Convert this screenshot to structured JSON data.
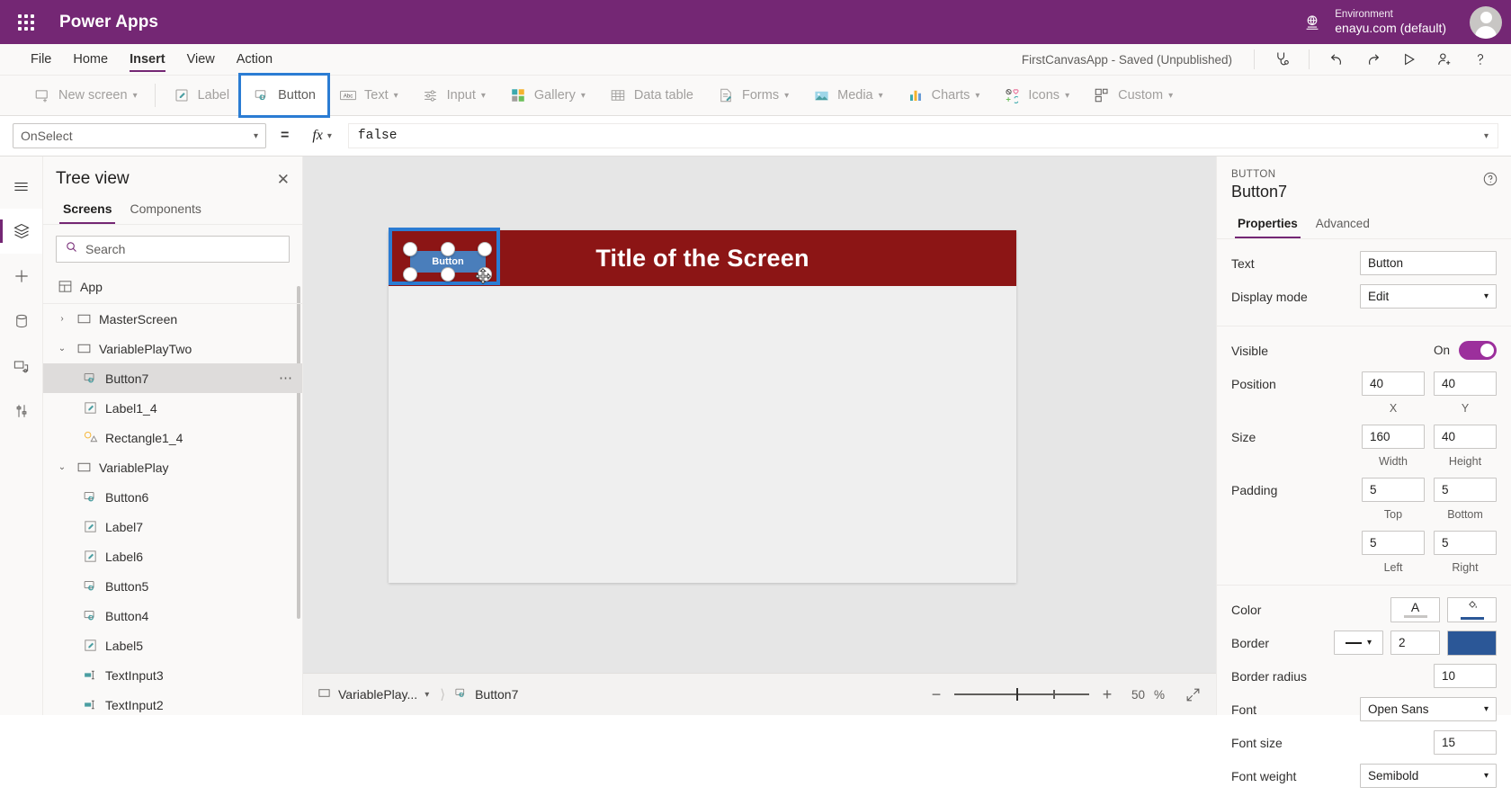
{
  "topbar": {
    "waffle_label": "app-launcher",
    "brand": "Power Apps",
    "environment_label": "Environment",
    "environment_name": "enayu.com (default)"
  },
  "menubar": {
    "items": [
      "File",
      "Home",
      "Insert",
      "View",
      "Action"
    ],
    "active": "Insert",
    "saved_status": "FirstCanvasApp - Saved (Unpublished)",
    "icons": [
      "health-check-icon",
      "undo-icon",
      "redo-icon",
      "play-icon",
      "share-icon",
      "help-icon"
    ]
  },
  "ribbon": {
    "items": [
      {
        "label": "New screen",
        "icon": "new-screen-icon",
        "caret": true,
        "selected": false
      },
      {
        "label": "Label",
        "icon": "label-icon",
        "caret": false,
        "selected": false
      },
      {
        "label": "Button",
        "icon": "button-icon",
        "caret": false,
        "selected": true
      },
      {
        "label": "Text",
        "icon": "text-icon",
        "caret": true,
        "selected": false
      },
      {
        "label": "Input",
        "icon": "input-icon",
        "caret": true,
        "selected": false
      },
      {
        "label": "Gallery",
        "icon": "gallery-icon",
        "caret": true,
        "selected": false
      },
      {
        "label": "Data table",
        "icon": "data-table-icon",
        "caret": false,
        "selected": false
      },
      {
        "label": "Forms",
        "icon": "forms-icon",
        "caret": true,
        "selected": false
      },
      {
        "label": "Media",
        "icon": "media-icon",
        "caret": true,
        "selected": false
      },
      {
        "label": "Charts",
        "icon": "charts-icon",
        "caret": true,
        "selected": false
      },
      {
        "label": "Icons",
        "icon": "icons-icon",
        "caret": true,
        "selected": false
      },
      {
        "label": "Custom",
        "icon": "custom-icon",
        "caret": true,
        "selected": false
      }
    ]
  },
  "formula_bar": {
    "property": "OnSelect",
    "equals": "=",
    "fx": "fx",
    "value": "false"
  },
  "rail": {
    "items": [
      "hamburger-icon",
      "tree-view-icon",
      "insert-icon",
      "data-icon",
      "media-icon",
      "advanced-tools-icon"
    ],
    "active_index": 1
  },
  "treeview": {
    "title": "Tree view",
    "close": "✕",
    "tabs": [
      "Screens",
      "Components"
    ],
    "active_tab": "Screens",
    "search_placeholder": "Search",
    "items": [
      {
        "label": "App",
        "icon": "app-icon",
        "indent": 0,
        "caret": "",
        "selected": false,
        "type": "app"
      },
      {
        "label": "MasterScreen",
        "icon": "screen-icon",
        "indent": 0,
        "caret": "›",
        "selected": false,
        "type": "screen"
      },
      {
        "label": "VariablePlayTwo",
        "icon": "screen-icon",
        "indent": 0,
        "caret": "⌄",
        "selected": false,
        "type": "screen"
      },
      {
        "label": "Button7",
        "icon": "button-icon",
        "indent": 1,
        "caret": "",
        "selected": true,
        "type": "control"
      },
      {
        "label": "Label1_4",
        "icon": "label-icon",
        "indent": 1,
        "caret": "",
        "selected": false,
        "type": "control"
      },
      {
        "label": "Rectangle1_4",
        "icon": "shape-icon",
        "indent": 1,
        "caret": "",
        "selected": false,
        "type": "control"
      },
      {
        "label": "VariablePlay",
        "icon": "screen-icon",
        "indent": 0,
        "caret": "⌄",
        "selected": false,
        "type": "screen"
      },
      {
        "label": "Button6",
        "icon": "button-icon",
        "indent": 1,
        "caret": "",
        "selected": false,
        "type": "control"
      },
      {
        "label": "Label7",
        "icon": "label-icon",
        "indent": 1,
        "caret": "",
        "selected": false,
        "type": "control"
      },
      {
        "label": "Label6",
        "icon": "label-icon",
        "indent": 1,
        "caret": "",
        "selected": false,
        "type": "control"
      },
      {
        "label": "Button5",
        "icon": "button-icon",
        "indent": 1,
        "caret": "",
        "selected": false,
        "type": "control"
      },
      {
        "label": "Button4",
        "icon": "button-icon",
        "indent": 1,
        "caret": "",
        "selected": false,
        "type": "control"
      },
      {
        "label": "Label5",
        "icon": "label-icon",
        "indent": 1,
        "caret": "",
        "selected": false,
        "type": "control"
      },
      {
        "label": "TextInput3",
        "icon": "text-input-icon",
        "indent": 1,
        "caret": "",
        "selected": false,
        "type": "control"
      },
      {
        "label": "TextInput2",
        "icon": "text-input-icon",
        "indent": 1,
        "caret": "",
        "selected": false,
        "type": "control"
      }
    ]
  },
  "canvas": {
    "screen_title": "Title of the Screen",
    "selected_control_text": "Button",
    "header_color": "#8c1515",
    "selection_color": "#2b7cd3",
    "button_fill": "#4a7ebb"
  },
  "statusbar": {
    "screen_crumb": "VariablePlay...",
    "control_crumb": "Button7",
    "zoom_minus": "−",
    "zoom_plus": "+",
    "zoom_value": "50",
    "zoom_unit": "%",
    "expand_icon": "fit-to-screen-icon"
  },
  "properties": {
    "kind": "BUTTON",
    "name": "Button7",
    "help_icon": "help-circle-icon",
    "tabs": [
      "Properties",
      "Advanced"
    ],
    "active_tab": "Properties",
    "text_label": "Text",
    "text_value": "Button",
    "display_mode_label": "Display mode",
    "display_mode_value": "Edit",
    "visible_label": "Visible",
    "visible_state": "On",
    "position_label": "Position",
    "position_x": "40",
    "position_y": "40",
    "position_x_sub": "X",
    "position_y_sub": "Y",
    "size_label": "Size",
    "size_width": "160",
    "size_height": "40",
    "size_width_sub": "Width",
    "size_height_sub": "Height",
    "padding_label": "Padding",
    "padding_top": "5",
    "padding_bottom": "5",
    "padding_left": "5",
    "padding_right": "5",
    "padding_top_sub": "Top",
    "padding_bottom_sub": "Bottom",
    "padding_left_sub": "Left",
    "padding_right_sub": "Right",
    "color_label": "Color",
    "color_text_icon": "A",
    "color_fill_icon": "fill-bucket-icon",
    "border_label": "Border",
    "border_width": "2",
    "border_color": "#2b5797",
    "border_radius_label": "Border radius",
    "border_radius_value": "10",
    "font_label": "Font",
    "font_value": "Open Sans",
    "font_size_label": "Font size",
    "font_size_value": "15",
    "font_weight_label": "Font weight",
    "font_weight_value": "Semibold"
  }
}
